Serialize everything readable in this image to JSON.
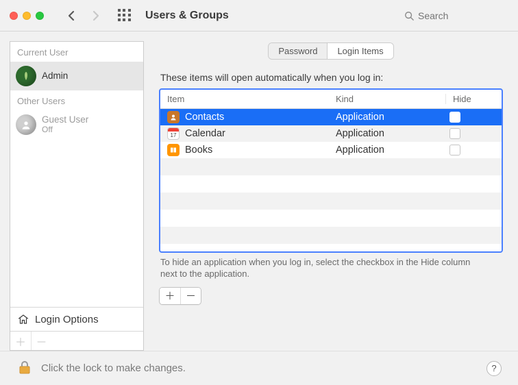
{
  "toolbar": {
    "title": "Users & Groups",
    "search_placeholder": "Search"
  },
  "sidebar": {
    "current_label": "Current User",
    "other_label": "Other Users",
    "users": [
      {
        "name": "Admin",
        "sub": "",
        "selected": true
      },
      {
        "name": "Guest User",
        "sub": "Off",
        "selected": false
      }
    ],
    "login_options_label": "Login Options"
  },
  "tabs": [
    {
      "label": "Password",
      "active": false
    },
    {
      "label": "Login Items",
      "active": true
    }
  ],
  "login_items": {
    "hint": "These items will open automatically when you log in:",
    "columns": {
      "item": "Item",
      "kind": "Kind",
      "hide": "Hide"
    },
    "rows": [
      {
        "name": "Contacts",
        "kind": "Application",
        "hide": false,
        "selected": true,
        "icon": "contacts"
      },
      {
        "name": "Calendar",
        "kind": "Application",
        "hide": false,
        "selected": false,
        "icon": "calendar",
        "cal_day": "17"
      },
      {
        "name": "Books",
        "kind": "Application",
        "hide": false,
        "selected": false,
        "icon": "books"
      }
    ],
    "footnote": "To hide an application when you log in, select the checkbox in the Hide column next to the application."
  },
  "lock_text": "Click the lock to make changes.",
  "help_label": "?"
}
